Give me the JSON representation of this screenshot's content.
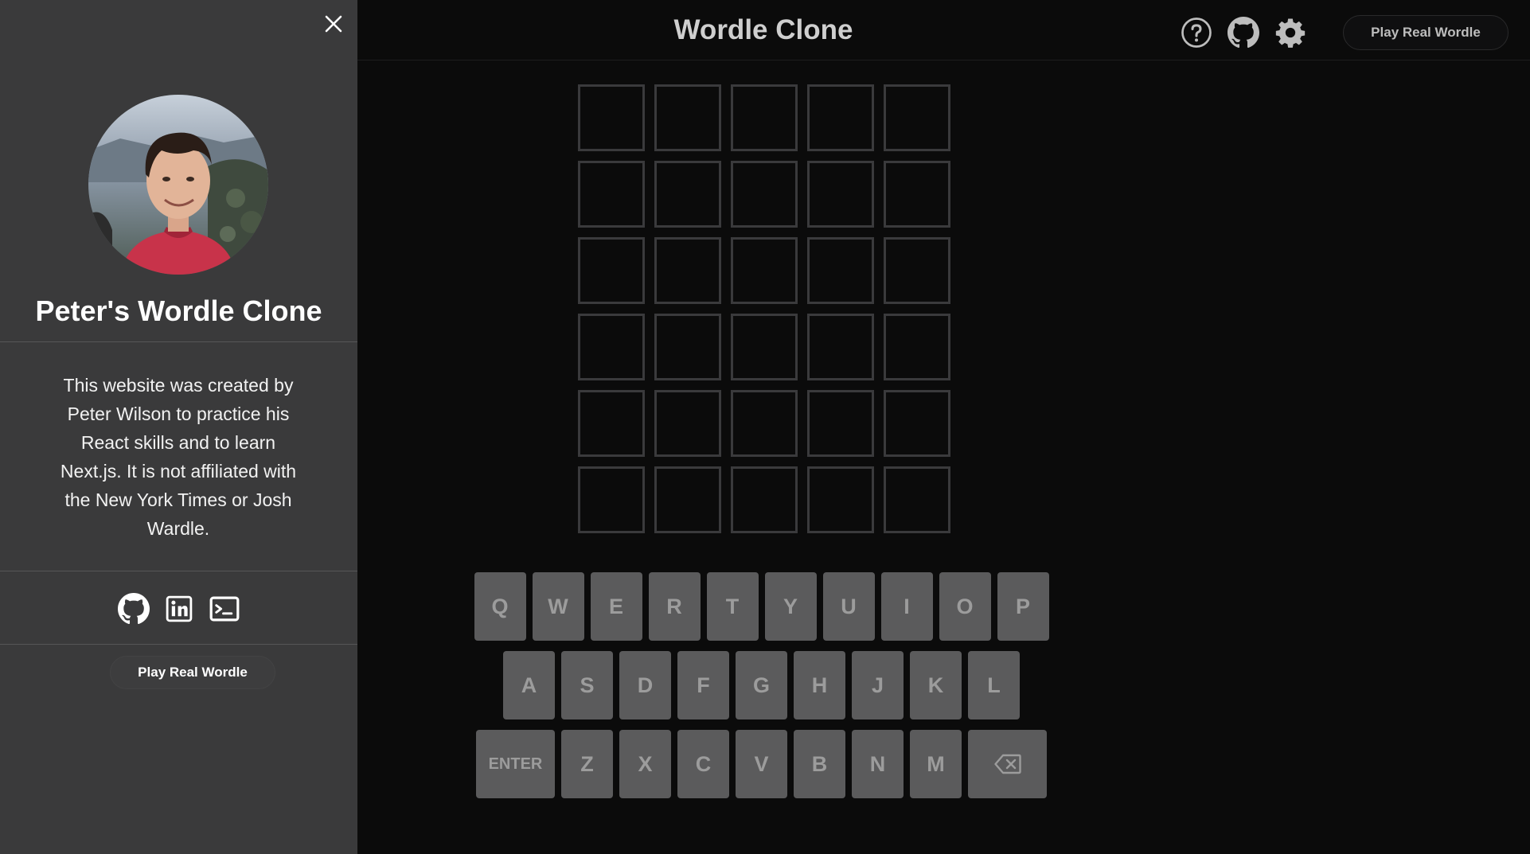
{
  "sidebar": {
    "title": "Peter's Wordle Clone",
    "description": "This website was created by Peter Wilson to practice his React skills and to learn Next.js. It is not affiliated with the New York Times or Josh Wardle.",
    "social_icons": [
      "github-icon",
      "linkedin-icon",
      "terminal-icon"
    ],
    "play_label": "Play Real Wordle",
    "close_icon": "close-icon"
  },
  "header": {
    "title": "Wordle Clone",
    "icons": [
      "help-icon",
      "github-icon",
      "settings-icon"
    ],
    "play_label": "Play Real Wordle"
  },
  "board": {
    "rows": [
      [
        "",
        "",
        "",
        "",
        ""
      ],
      [
        "",
        "",
        "",
        "",
        ""
      ],
      [
        "",
        "",
        "",
        "",
        ""
      ],
      [
        "",
        "",
        "",
        "",
        ""
      ],
      [
        "",
        "",
        "",
        "",
        ""
      ],
      [
        "",
        "",
        "",
        "",
        ""
      ]
    ]
  },
  "keyboard": {
    "rows": [
      [
        "Q",
        "W",
        "E",
        "R",
        "T",
        "Y",
        "U",
        "I",
        "O",
        "P"
      ],
      [
        "A",
        "S",
        "D",
        "F",
        "G",
        "H",
        "J",
        "K",
        "L"
      ],
      [
        "ENTER",
        "Z",
        "X",
        "C",
        "V",
        "B",
        "N",
        "M",
        "BACKSPACE"
      ]
    ]
  },
  "colors": {
    "sidebar_bg": "#3a3a3b",
    "page_bg": "#0b0b0b",
    "key_bg": "#5b5b5c",
    "tile_border": "#3a3a3c"
  }
}
